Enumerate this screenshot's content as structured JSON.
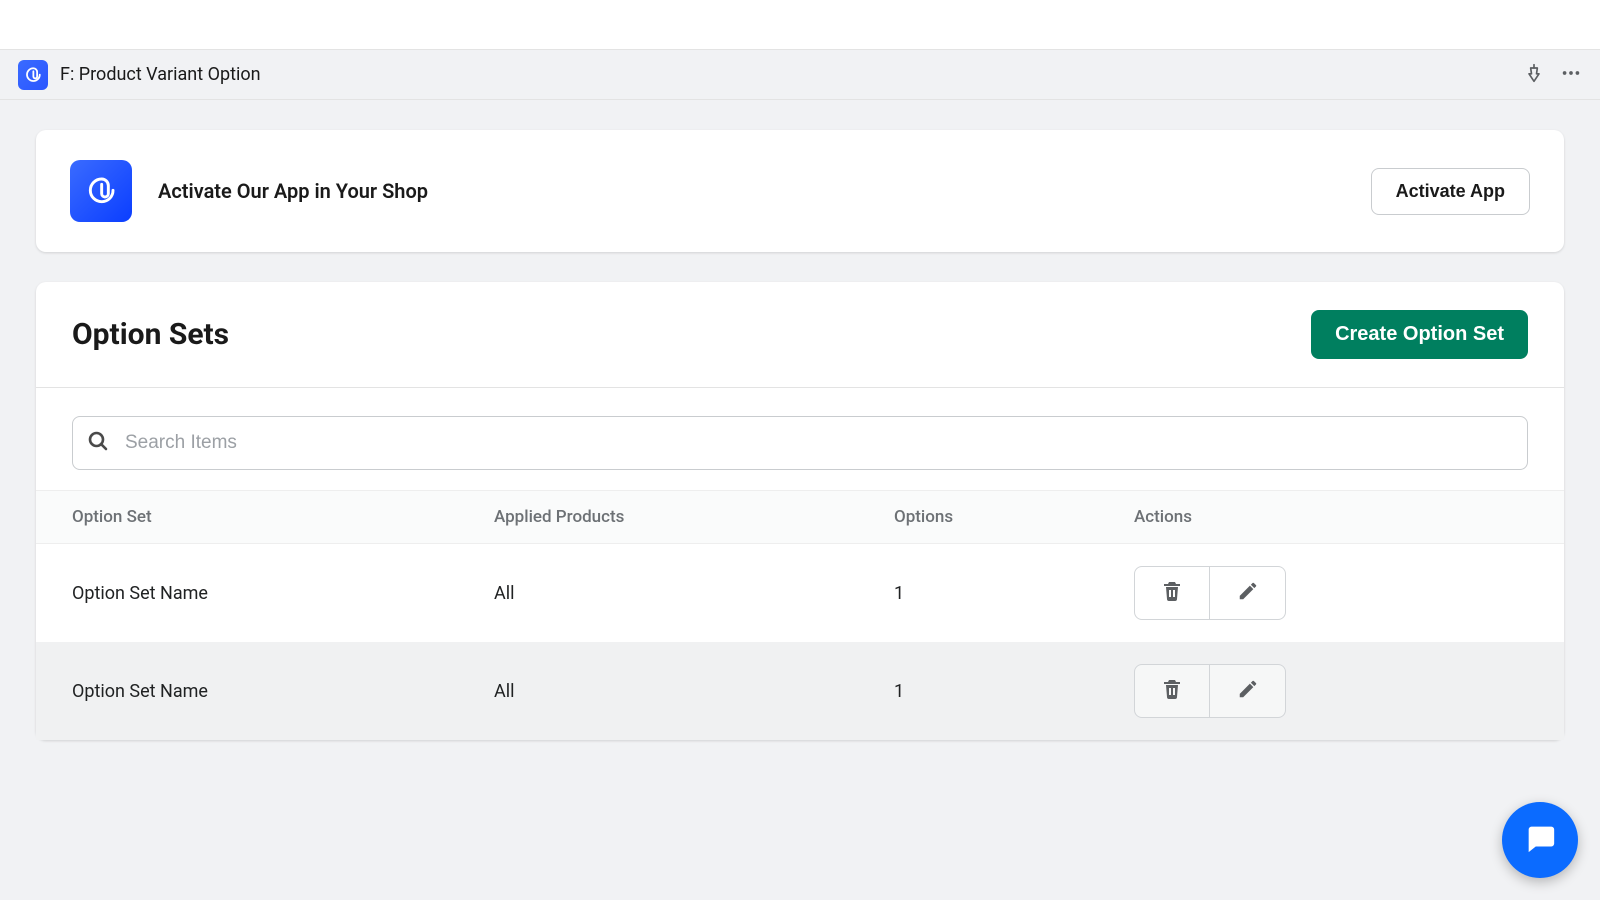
{
  "app_header": {
    "title": "F: Product Variant Option"
  },
  "activate_banner": {
    "text": "Activate Our App in Your Shop",
    "button_label": "Activate App"
  },
  "option_sets": {
    "title": "Option Sets",
    "create_button_label": "Create Option Set",
    "search_placeholder": "Search Items",
    "columns": {
      "option_set": "Option Set",
      "applied_products": "Applied Products",
      "options": "Options",
      "actions": "Actions"
    },
    "rows": [
      {
        "name": "Option Set Name",
        "applied": "All",
        "options": "1"
      },
      {
        "name": "Option Set Name",
        "applied": "All",
        "options": "1"
      }
    ]
  },
  "colors": {
    "primary_green": "#007f5f",
    "accent_blue": "#0b6bff"
  }
}
